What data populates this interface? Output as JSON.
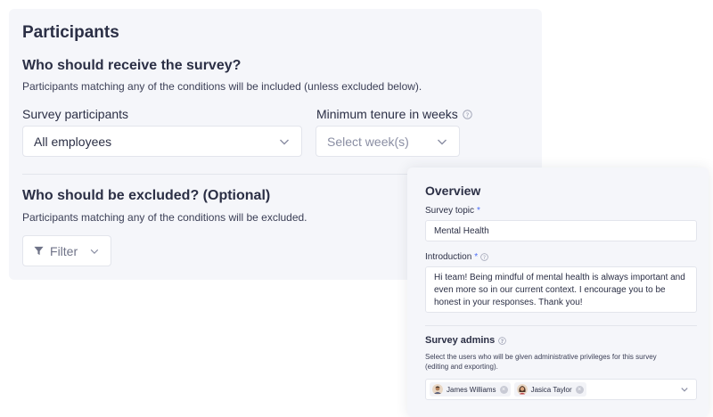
{
  "participants": {
    "title": "Participants",
    "receive_heading": "Who should receive the survey?",
    "receive_desc": "Participants matching any of the conditions will be included (unless excluded below).",
    "survey_participants_label": "Survey participants",
    "survey_participants_value": "All employees",
    "min_tenure_label": "Minimum tenure in weeks",
    "min_tenure_placeholder": "Select week(s)",
    "exclude_heading": "Who should be excluded? (Optional)",
    "exclude_desc": "Participants matching any of the conditions will be excluded.",
    "filter_label": "Filter"
  },
  "overview": {
    "title": "Overview",
    "topic_label": "Survey topic",
    "topic_required": "*",
    "topic_value": "Mental Health",
    "intro_label": "Introduction",
    "intro_required": "*",
    "intro_value": "Hi team! Being mindful of mental health is always important and even more so in our current context. I encourage you to be honest in your responses. Thank you!",
    "admins_label": "Survey admins",
    "admins_desc": "Select the users who will be given administrative privileges for this survey (editing and exporting).",
    "admins": [
      {
        "name": "James Williams"
      },
      {
        "name": "Jasica Taylor"
      }
    ]
  },
  "icons": {
    "info": "info-icon",
    "chevron": "chevron-down-icon",
    "filter": "filter-icon",
    "remove": "close-icon"
  },
  "colors": {
    "card_bg": "#f5f6fa",
    "text": "#2b2f45",
    "placeholder": "#8a8ea3",
    "required": "#4a6cf7",
    "border": "#e3e5ec"
  }
}
